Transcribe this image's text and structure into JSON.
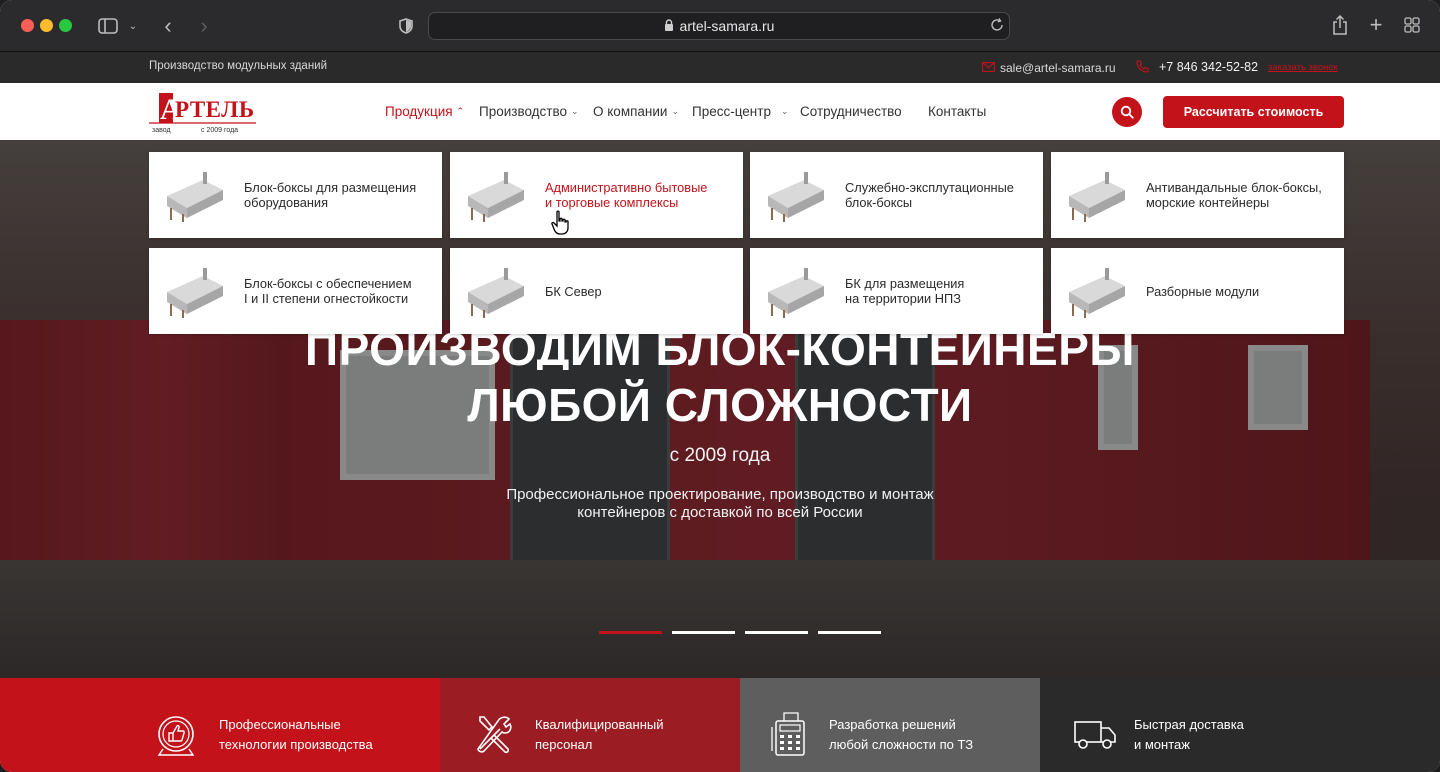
{
  "browser": {
    "url": "artel-samara.ru"
  },
  "topbar": {
    "tagline": "Производство модульных зданий",
    "email": "sale@artel-samara.ru",
    "phone": "+7 846 342-52-82",
    "callback": "заказать звонок"
  },
  "logo": {
    "brand": "АРТЕЛЬ",
    "caption_left": "завод",
    "caption_right": "с 2009 года"
  },
  "nav": {
    "items": [
      "Продукция",
      "Производство",
      "О компании",
      "Пресс-центр",
      "Сотрудничество",
      "Контакты"
    ],
    "cta": "Рассчитать стоимость"
  },
  "dropdown": {
    "items": [
      "Блок-боксы для размещения\nоборудования",
      "Административно бытовые\nи торговые комплексы",
      "Служебно-эксплутационные\nблок-боксы",
      "Антивандальные блок-боксы,\nморские контейнеры",
      "Блок-боксы с обеспечением\nI и II степени огнестойкости",
      "БК Север",
      "БК для размещения\nна территории НПЗ",
      "Разборные модули"
    ],
    "active_index": 1
  },
  "hero": {
    "title_line1": "ПРОИЗВОДИМ БЛОК-КОНТЕЙНЕРЫ",
    "title_line2": "ЛЮБОЙ СЛОЖНОСТИ",
    "since": "с 2009 года",
    "desc_line1": "Профессиональное проектирование, производство и монтаж",
    "desc_line2": "контейнеров с доставкой по всей России",
    "slides": 4,
    "active_slide": 0
  },
  "features": [
    {
      "text": "Профессиональные\nтехнологии производства",
      "color": "#c4121a",
      "icon": "thumbs-up-badge-icon"
    },
    {
      "text": "Квалифицированный\nперсонал",
      "color": "#9b1c22",
      "icon": "tools-icon"
    },
    {
      "text": "Разработка решений\nлюбой сложности по ТЗ",
      "color": "#5e5e5e",
      "icon": "calculator-icon"
    },
    {
      "text": "Быстрая доставка\nи монтаж",
      "color": "#2a2a2a",
      "icon": "truck-icon"
    }
  ],
  "colors": {
    "accent": "#c4121a"
  }
}
